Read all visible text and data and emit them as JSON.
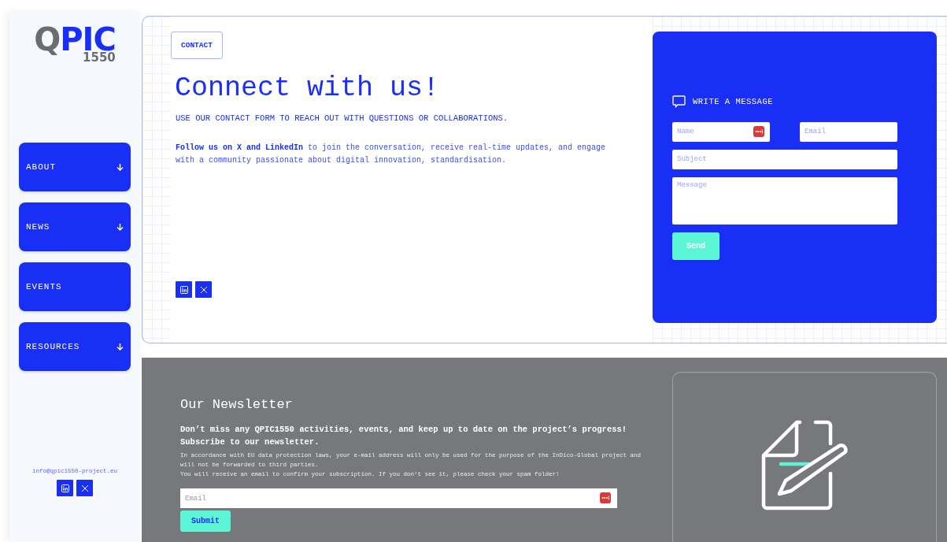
{
  "sidebar": {
    "logo": {
      "text": "QPIC",
      "number": "1550"
    },
    "nav": [
      {
        "label": "ABOUT",
        "expandable": true
      },
      {
        "label": "NEWS",
        "expandable": true
      },
      {
        "label": "EVENTS",
        "expandable": false
      },
      {
        "label": "RESOURCES",
        "expandable": true
      }
    ],
    "email": "info@qpic1550-project.eu",
    "socials": [
      {
        "kind": "linkedin"
      },
      {
        "kind": "x"
      }
    ]
  },
  "contact": {
    "tag": "CONTACT",
    "title": "Connect with us!",
    "subtitle": "USE OUR CONTACT FORM TO REACH OUT WITH QUESTIONS OR COLLABORATIONS.",
    "intro": "**Follow us on X and LinkedIn** to join the conversation, receive real-time updates, and engage with a community passionate about digital innovation, standardisation.",
    "socials": [
      {
        "kind": "linkedin"
      },
      {
        "kind": "x"
      }
    ]
  },
  "form": {
    "title": "WRITE A MESSAGE",
    "fields": [
      {
        "kind": "input",
        "placeholder": "Name",
        "autofill_icon": true
      },
      {
        "kind": "input",
        "placeholder": "Email",
        "autofill_icon": false
      },
      {
        "kind": "input",
        "placeholder": "Subject",
        "autofill_icon": false
      },
      {
        "kind": "textarea",
        "placeholder": "Message",
        "autofill_icon": false
      }
    ],
    "button": "Send"
  },
  "newsletter": {
    "title": "Our Newsletter",
    "lead": "Don’t miss any QPIC1550 activities, events, and keep up to date on the project’s progress!",
    "cta": "Subscribe to our newsletter.",
    "notice": [
      "In accordance with EU data protection laws, your e-mail address will only be used for the purpose of the InDico-Global project and will not be forwarded to third parties.",
      "You will receive an email to confirm your subscription. If you don’t see it, please check your spam folder!"
    ],
    "email_placeholder": "Email",
    "autofill_icon": true,
    "button": "Submit"
  }
}
